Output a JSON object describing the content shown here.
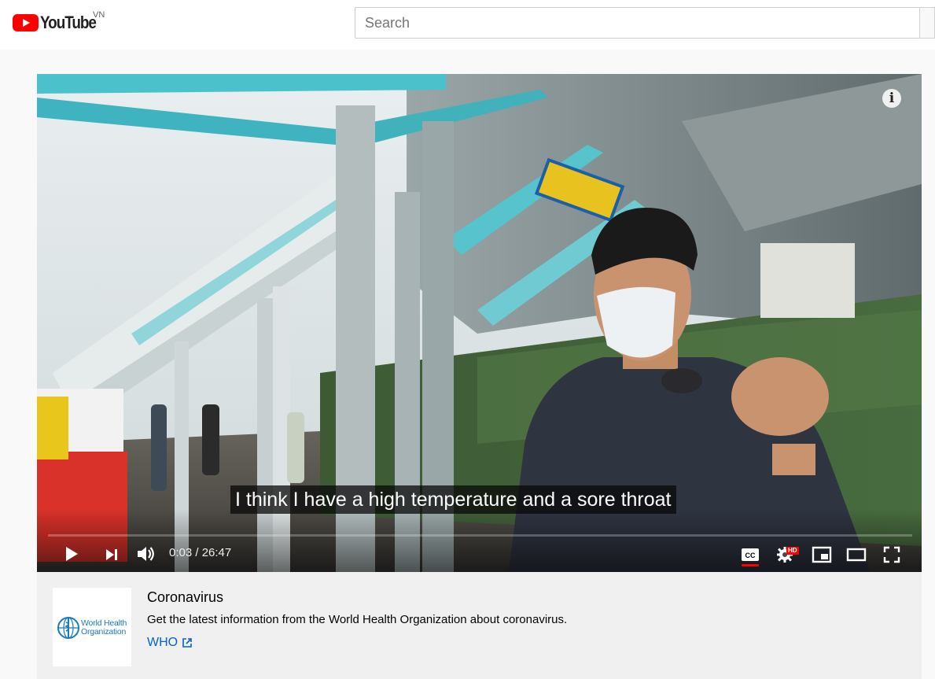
{
  "header": {
    "logo_text": "YouTube",
    "country_code": "VN",
    "search": {
      "placeholder": "Search",
      "value": ""
    }
  },
  "player": {
    "caption": "I think I have a high temperature and a sore throat",
    "time_display": "0:03 / 26:47",
    "progress_fraction": 0.002,
    "captions_on": true,
    "hd_badge": "HD",
    "info_icon": "i",
    "icons": {
      "play": "play-icon",
      "next": "next-icon",
      "volume": "volume-icon",
      "captions": "cc-icon",
      "settings": "gear-icon",
      "miniplayer": "miniplayer-icon",
      "theater": "theater-icon",
      "fullscreen": "fullscreen-icon"
    }
  },
  "info_panel": {
    "title": "Coronavirus",
    "description": "Get the latest information from the World Health Organization about coronavirus.",
    "link_label": "WHO",
    "logo_text": "World Health Organization",
    "link_color": "#065fd4"
  },
  "colors": {
    "brand_red": "#ff0000",
    "who_blue": "#1a7bc0"
  }
}
